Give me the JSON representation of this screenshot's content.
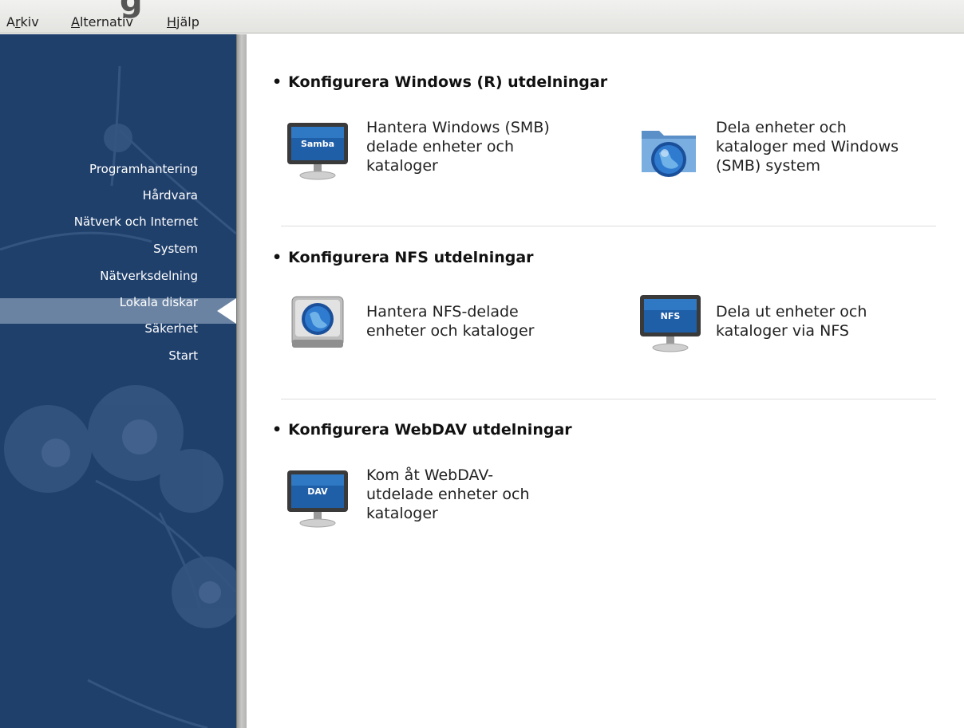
{
  "menubar": {
    "items": [
      {
        "label": "Arkiv",
        "underline_index": 1
      },
      {
        "label": "Alternativ",
        "underline_index": 0
      },
      {
        "label": "Hjälp",
        "underline_index": 0
      }
    ]
  },
  "sidebar": {
    "items": [
      {
        "label": "Programhantering",
        "active": false
      },
      {
        "label": "Hårdvara",
        "active": false
      },
      {
        "label": "Nätverk och Internet",
        "active": false
      },
      {
        "label": "System",
        "active": false
      },
      {
        "label": "Nätverksdelning",
        "active": true
      },
      {
        "label": "Lokala diskar",
        "active": false
      },
      {
        "label": "Säkerhet",
        "active": false
      },
      {
        "label": "Start",
        "active": false
      }
    ]
  },
  "sections": [
    {
      "heading": "Konfigurera Windows (R) utdelningar",
      "items": [
        {
          "label_lines": [
            "Hantera Windows (SMB)",
            "delade enheter och",
            "kataloger"
          ],
          "icon": "monitor-icon",
          "icon_text": "Samba"
        },
        {
          "label_lines": [
            "Dela enheter och",
            "kataloger med Windows",
            "(SMB) system"
          ],
          "icon": "folder-globe-icon"
        }
      ]
    },
    {
      "heading": "Konfigurera NFS utdelningar",
      "items": [
        {
          "label_lines": [
            "Hantera NFS-delade",
            "enheter och kataloger"
          ],
          "icon": "drive-globe-icon"
        },
        {
          "label_lines": [
            "Dela ut enheter och",
            "kataloger via NFS"
          ],
          "icon": "monitor-icon",
          "icon_text": "NFS"
        }
      ]
    },
    {
      "heading": "Konfigurera WebDAV utdelningar",
      "items": [
        {
          "label_lines": [
            "Kom åt WebDAV-",
            "utdelade enheter och",
            "kataloger"
          ],
          "icon": "monitor-icon",
          "icon_text": "DAV"
        }
      ]
    }
  ],
  "colors": {
    "sidebar_bg": "#20406c",
    "sidebar_active": "#6a83a3",
    "monitor_screen": "#1f5fa8"
  }
}
